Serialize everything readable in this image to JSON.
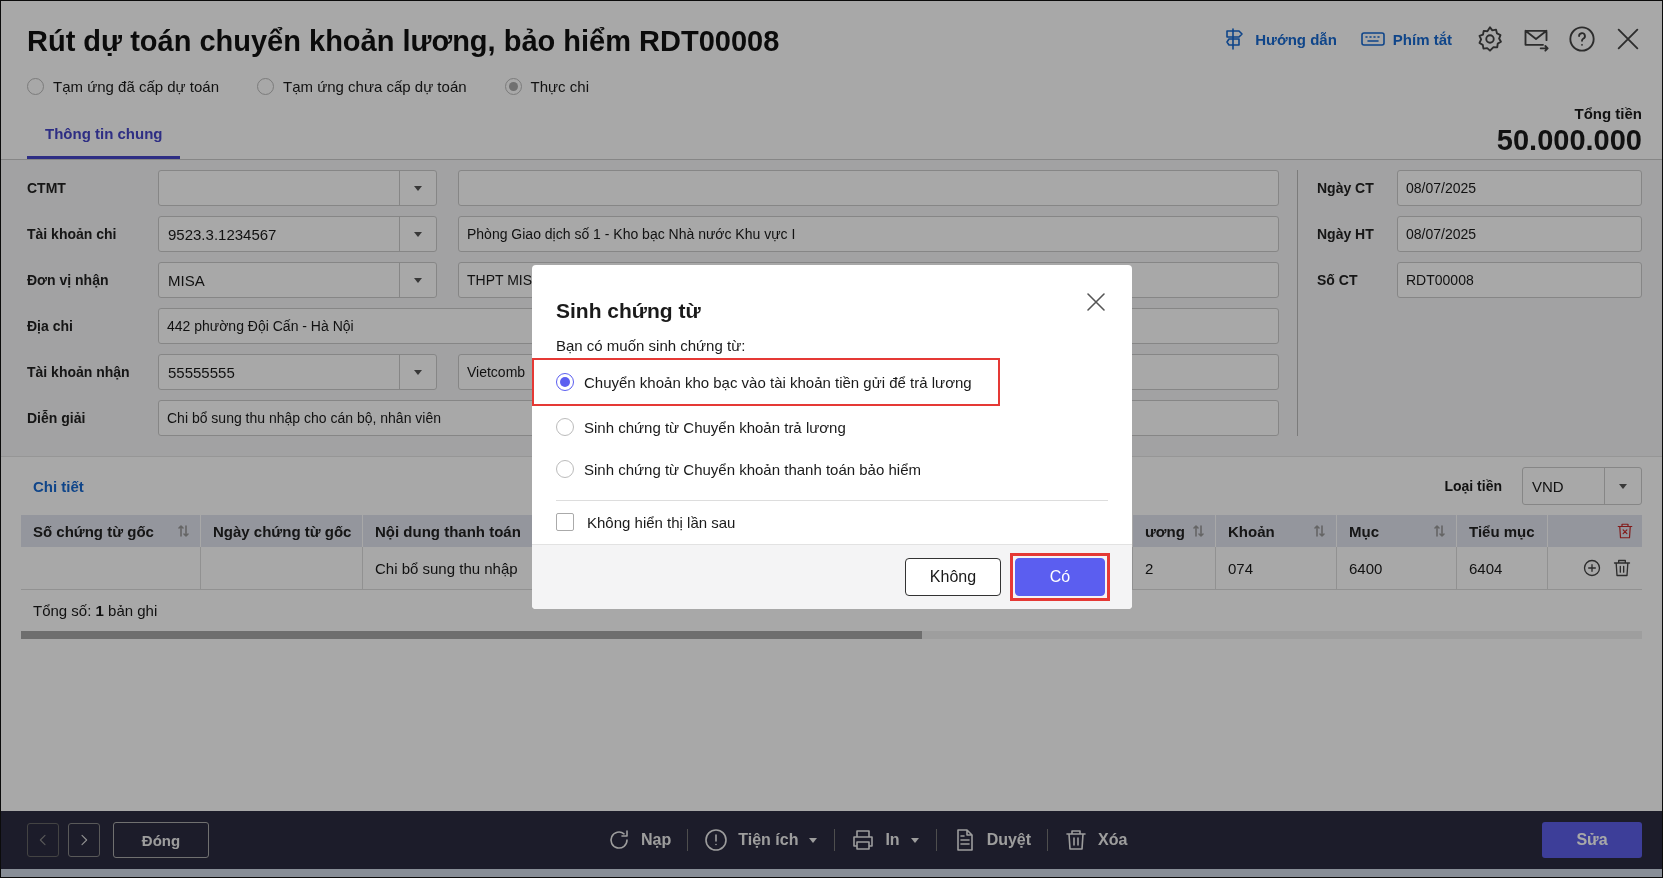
{
  "window": {
    "title": "Rút dự toán chuyển khoản lương, bảo hiểm RDT00008"
  },
  "header_links": [
    {
      "label": "Hướng dẫn"
    },
    {
      "label": "Phím tắt"
    }
  ],
  "payment_types": [
    {
      "label": "Tạm ứng đã cấp dự toán",
      "selected": false
    },
    {
      "label": "Tạm ứng chưa cấp dự toán",
      "selected": false
    },
    {
      "label": "Thực chi",
      "selected": true
    }
  ],
  "tabs": [
    {
      "label": "Thông tin chung",
      "selected": true
    }
  ],
  "total": {
    "label": "Tổng tiền",
    "value": "50.000.000"
  },
  "form": {
    "left_rows": [
      {
        "kind": "pair",
        "label": "CTMT"
      },
      {
        "kind": "pair",
        "label": "Tài khoản chi",
        "value": "9523.3.1234567",
        "detail": "Phòng Giao dịch số 1 - Kho bạc Nhà nước Khu vực I"
      },
      {
        "kind": "pair",
        "label": "Đơn vị nhận",
        "value": "MISA",
        "detail": "THPT MIS"
      },
      {
        "kind": "wide",
        "label": "Địa chi",
        "value": "442 phường Đội Cấn - Hà Nội"
      },
      {
        "kind": "pair",
        "label": "Tài khoản nhận",
        "value": "55555555",
        "detail": "Vietcomb"
      },
      {
        "kind": "wide",
        "label": "Diễn giải",
        "value": "Chi bổ sung thu nhập cho cán bộ, nhân viên"
      }
    ],
    "right_rows": [
      {
        "label": "Ngày CT",
        "value": "08/07/2025"
      },
      {
        "label": "Ngày HT",
        "value": "08/07/2025"
      },
      {
        "label": "Số CT",
        "value": "RDT00008"
      }
    ]
  },
  "details": {
    "title": "Chi tiết",
    "currency": {
      "label": "Loại tiền",
      "value": "VND"
    },
    "columns": [
      {
        "label": "Số chứng từ gốc",
        "sortable": true
      },
      {
        "label": "Ngày chứng từ gốc",
        "sortable": false
      },
      {
        "label": "Nội dung thanh toán",
        "sortable": false
      },
      {
        "label": "ương",
        "sortable": true
      },
      {
        "label": "Khoản",
        "sortable": true
      },
      {
        "label": "Mục",
        "sortable": true
      },
      {
        "label": "Tiểu mục",
        "sortable": false
      }
    ],
    "rows": [
      {
        "cells": [
          null,
          null,
          "Chi bổ sung thu nhập",
          "2",
          "074",
          "6400",
          "6404"
        ]
      }
    ],
    "summary": "Tổng số: **1** bản ghi"
  },
  "dialog": {
    "title": "Sinh chứng từ",
    "prompt": "Bạn có muốn sinh chứng từ:",
    "options": [
      {
        "label": "Chuyển khoản kho bạc vào tài khoản tiền gửi để trả lương",
        "selected": true,
        "highlighted": true
      },
      {
        "label": "Sinh chứng từ Chuyển khoản trả lương",
        "selected": false,
        "highlighted": false
      },
      {
        "label": "Sinh chứng từ Chuyển khoản thanh toán bảo hiểm",
        "selected": false,
        "highlighted": false
      }
    ],
    "checkbox": {
      "label": "Không hiển thị lần sau",
      "checked": false
    },
    "buttons": [
      {
        "label": "Không",
        "kind": "secondary",
        "highlighted": false
      },
      {
        "label": "Có",
        "kind": "primary",
        "highlighted": true
      }
    ]
  },
  "bottom_bar": {
    "close_button": "Đóng",
    "tools": [
      {
        "label": "Nạp",
        "menu": false
      },
      {
        "label": "Tiện ích",
        "menu": true
      },
      {
        "label": "In",
        "menu": true
      },
      {
        "label": "Duyệt",
        "menu": false
      },
      {
        "label": "Xóa",
        "menu": false
      }
    ],
    "edit_button": "Sửa"
  }
}
